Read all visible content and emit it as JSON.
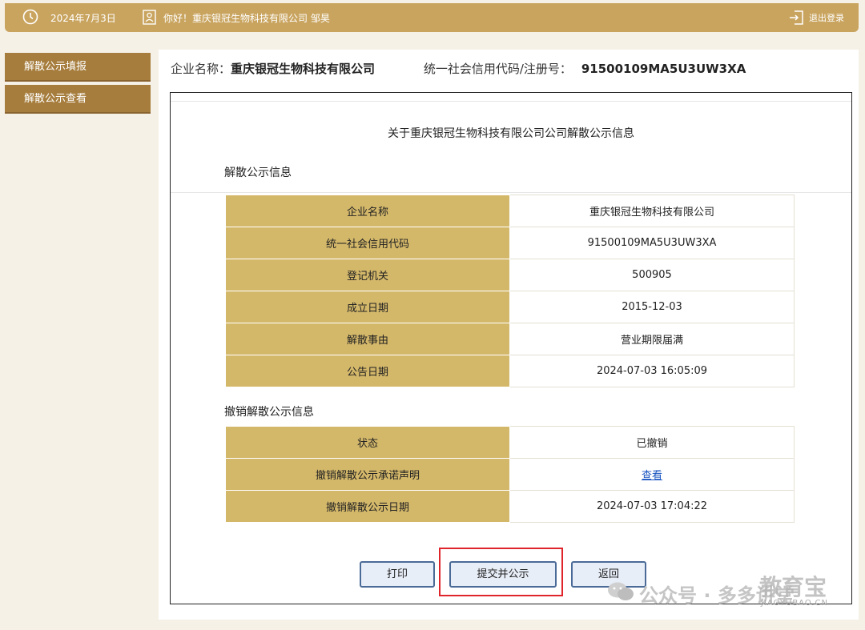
{
  "header": {
    "date": "2024年7月3日",
    "greeting": "你好！重庆银冠生物科技有限公司   邹昊",
    "logout_label": "退出登录"
  },
  "sidebar": {
    "items": [
      {
        "label": "解散公示填报"
      },
      {
        "label": "解散公示查看"
      }
    ]
  },
  "company": {
    "name_label": "企业名称：",
    "name": "重庆银冠生物科技有限公司",
    "code_label": "统一社会信用代码/注册号：",
    "code": "91500109MA5U3UW3XA"
  },
  "panel": {
    "title": "关于重庆银冠生物科技有限公司公司解散公示信息",
    "section1_title": "解散公示信息",
    "section1_rows": [
      {
        "key": "企业名称",
        "value": "重庆银冠生物科技有限公司"
      },
      {
        "key": "统一社会信用代码",
        "value": "91500109MA5U3UW3XA"
      },
      {
        "key": "登记机关",
        "value": "500905"
      },
      {
        "key": "成立日期",
        "value": "2015-12-03"
      },
      {
        "key": "解散事由",
        "value": "营业期限届满"
      },
      {
        "key": "公告日期",
        "value": "2024-07-03 16:05:09"
      }
    ],
    "section2_title": "撤销解散公示信息",
    "section2_rows": [
      {
        "key": "状态",
        "value": "已撤销"
      },
      {
        "key": "撤销解散公示承诺声明",
        "value": "查看"
      },
      {
        "key": "撤销解散公示日期",
        "value": "2024-07-03 17:04:22"
      }
    ]
  },
  "buttons": {
    "print": "打印",
    "submit": "提交并公示",
    "back": "返回"
  },
  "watermark": {
    "text": "公众号 · 多多讲堂",
    "logo": "教育宝",
    "domain": "JIAOYUBAO.CN"
  },
  "colors": {
    "topbar": "#c9a45f",
    "sidebar": "#a67d3d",
    "table_key_bg": "#d4b86a",
    "highlight": "#e0242c"
  }
}
